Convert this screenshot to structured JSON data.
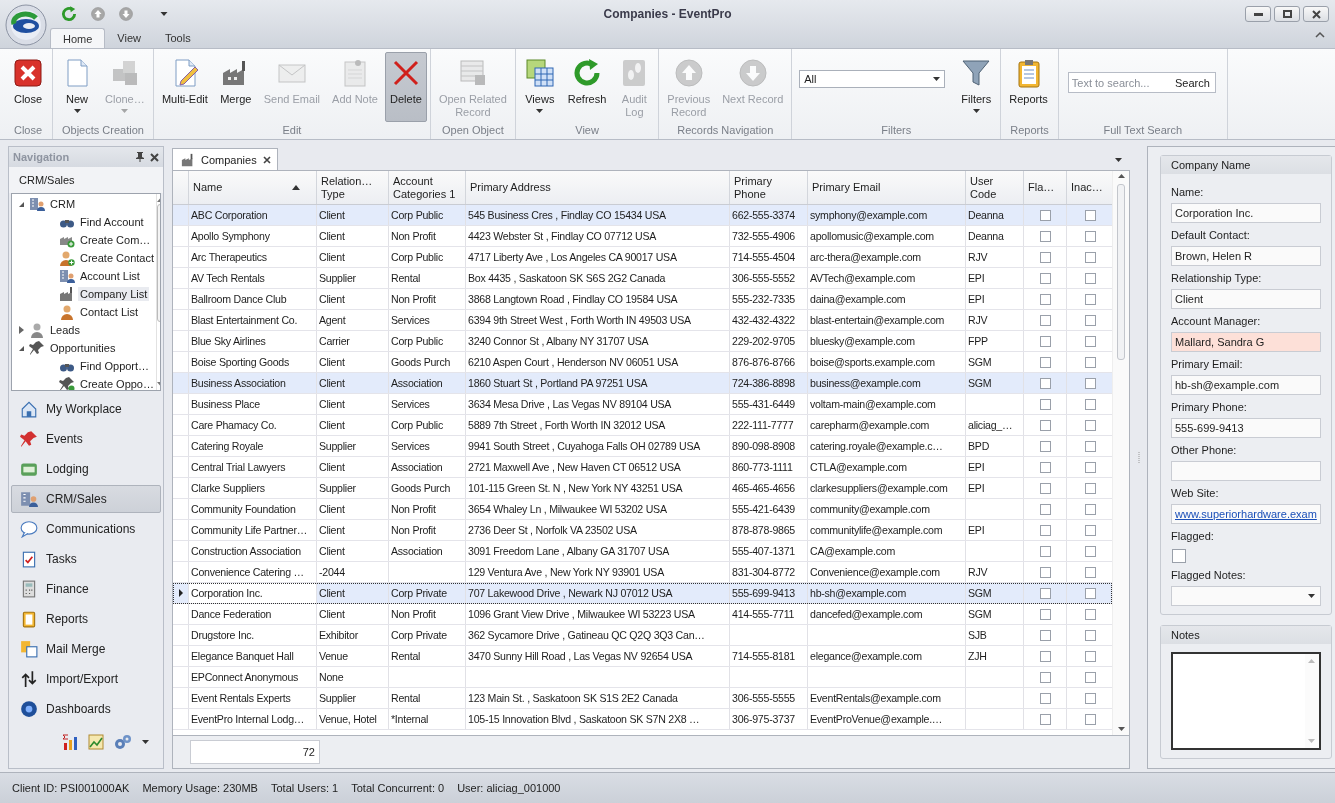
{
  "window": {
    "title": "Companies - EventPro"
  },
  "ribbon_tabs": [
    {
      "label": "Home",
      "selected": true
    },
    {
      "label": "View",
      "selected": false
    },
    {
      "label": "Tools",
      "selected": false
    }
  ],
  "ribbon_groups": [
    {
      "label": "Close",
      "buttons": [
        {
          "label": "Close",
          "disabled": false,
          "pressed": false,
          "dropdown": false
        }
      ]
    },
    {
      "label": "Objects Creation",
      "buttons": [
        {
          "label": "New",
          "disabled": false,
          "pressed": false,
          "dropdown": true
        },
        {
          "label": "Clone…",
          "disabled": true,
          "pressed": false,
          "dropdown": true
        }
      ]
    },
    {
      "label": "Edit",
      "buttons": [
        {
          "label": "Multi-Edit",
          "disabled": false,
          "pressed": false,
          "dropdown": false
        },
        {
          "label": "Merge",
          "disabled": false,
          "pressed": false,
          "dropdown": false
        },
        {
          "label": "Send Email",
          "disabled": true,
          "pressed": false,
          "dropdown": false
        },
        {
          "label": "Add Note",
          "disabled": true,
          "pressed": false,
          "dropdown": false
        },
        {
          "label": "Delete",
          "disabled": false,
          "pressed": true,
          "dropdown": false
        }
      ]
    },
    {
      "label": "Open Object",
      "buttons": [
        {
          "label": "Open Related\nRecord",
          "disabled": true,
          "pressed": false,
          "dropdown": false
        }
      ]
    },
    {
      "label": "View",
      "buttons": [
        {
          "label": "Views",
          "disabled": false,
          "pressed": false,
          "dropdown": true
        },
        {
          "label": "Refresh",
          "disabled": false,
          "pressed": false,
          "dropdown": false
        },
        {
          "label": "Audit\nLog",
          "disabled": true,
          "pressed": false,
          "dropdown": false
        }
      ]
    },
    {
      "label": "Records Navigation",
      "buttons": [
        {
          "label": "Previous\nRecord",
          "disabled": true,
          "pressed": false,
          "dropdown": false
        },
        {
          "label": "Next Record",
          "disabled": true,
          "pressed": false,
          "dropdown": false
        }
      ]
    },
    {
      "label": "Filters",
      "combo": {
        "value": "All"
      },
      "buttons": [
        {
          "label": "Filters",
          "disabled": false,
          "pressed": false,
          "dropdown": true
        }
      ]
    },
    {
      "label": "Reports",
      "buttons": [
        {
          "label": "Reports",
          "disabled": false,
          "pressed": false,
          "dropdown": false
        }
      ]
    },
    {
      "label": "Full Text Search",
      "search": {
        "placeholder": "Text to search...",
        "button": "Search"
      }
    }
  ],
  "navigation": {
    "title": "Navigation",
    "section": "CRM/Sales",
    "tree": [
      {
        "label": "CRM",
        "expanded": true,
        "selected": false,
        "children": [
          {
            "label": "Find Account",
            "selected": false
          },
          {
            "label": "Create Com…",
            "selected": false
          },
          {
            "label": "Create Contact",
            "selected": false
          },
          {
            "label": "Account List",
            "selected": false
          },
          {
            "label": "Company List",
            "selected": true
          },
          {
            "label": "Contact List",
            "selected": false
          }
        ]
      },
      {
        "label": "Leads",
        "expanded": false,
        "selected": false
      },
      {
        "label": "Opportunities",
        "expanded": true,
        "selected": false,
        "children": [
          {
            "label": "Find Opport…",
            "selected": false
          },
          {
            "label": "Create Oppo…",
            "selected": false
          }
        ]
      }
    ],
    "items": [
      {
        "label": "My Workplace",
        "selected": false
      },
      {
        "label": "Events",
        "selected": false
      },
      {
        "label": "Lodging",
        "selected": false
      },
      {
        "label": "CRM/Sales",
        "selected": true
      },
      {
        "label": "Communications",
        "selected": false
      },
      {
        "label": "Tasks",
        "selected": false
      },
      {
        "label": "Finance",
        "selected": false
      },
      {
        "label": "Reports",
        "selected": false
      },
      {
        "label": "Mail Merge",
        "selected": false
      },
      {
        "label": "Import/Export",
        "selected": false
      },
      {
        "label": "Dashboards",
        "selected": false
      }
    ]
  },
  "document_tabs": [
    {
      "label": "Companies",
      "selected": true
    }
  ],
  "table": {
    "columns": [
      {
        "label": "Name",
        "sorted": true
      },
      {
        "label": "Relation…\nType",
        "sorted": false
      },
      {
        "label": "Account\nCategories 1",
        "sorted": false
      },
      {
        "label": "Primary Address",
        "sorted": false
      },
      {
        "label": "Primary\nPhone",
        "sorted": false
      },
      {
        "label": "Primary Email",
        "sorted": false
      },
      {
        "label": "User\nCode",
        "sorted": false
      },
      {
        "label": "Fla…",
        "sorted": false
      },
      {
        "label": "Inac…",
        "sorted": false
      }
    ],
    "rows": [
      {
        "name": "ABC Corporation",
        "relationship_type": "Client",
        "account_category": "Corp Public",
        "address": "545 Business Cres , Findlay CO 15434 USA",
        "phone": "662-555-3374",
        "email": "symphony@example.com",
        "user_code": "Deanna",
        "flagged": false,
        "inactive": false,
        "selected": true,
        "focused": false
      },
      {
        "name": "Apollo Symphony",
        "relationship_type": "Client",
        "account_category": "Non Profit",
        "address": "4423 Webster St , Findlay CO 07712 USA",
        "phone": "732-555-4906",
        "email": "apollomusic@example.com",
        "user_code": "Deanna",
        "flagged": false,
        "inactive": false,
        "selected": false,
        "focused": false
      },
      {
        "name": "Arc Therapeutics",
        "relationship_type": "Client",
        "account_category": "Corp Public",
        "address": "4717 Liberty Ave , Los Angeles CA 90017 USA",
        "phone": "714-555-4504",
        "email": "arc-thera@example.com",
        "user_code": "RJV",
        "flagged": false,
        "inactive": false,
        "selected": false,
        "focused": false
      },
      {
        "name": "AV Tech Rentals",
        "relationship_type": "Supplier",
        "account_category": "Rental",
        "address": "Box 4435 , Saskatoon SK S6S 2G2 Canada",
        "phone": "306-555-5552",
        "email": "AVTech@example.com",
        "user_code": "EPI",
        "flagged": false,
        "inactive": false,
        "selected": false,
        "focused": false
      },
      {
        "name": "Ballroom Dance Club",
        "relationship_type": "Client",
        "account_category": "Non Profit",
        "address": "3868 Langtown Road , Findlay CO 19584 USA",
        "phone": "555-232-7335",
        "email": "daina@example.com",
        "user_code": "EPI",
        "flagged": false,
        "inactive": false,
        "selected": false,
        "focused": false
      },
      {
        "name": "Blast Entertainment Co.",
        "relationship_type": "Agent",
        "account_category": "Services",
        "address": "6394 9th Street West , Forth Worth IN 49503 USA",
        "phone": "432-432-4322",
        "email": "blast-entertain@example.com",
        "user_code": "RJV",
        "flagged": false,
        "inactive": false,
        "selected": false,
        "focused": false
      },
      {
        "name": "Blue Sky Airlines",
        "relationship_type": "Carrier",
        "account_category": "Corp Public",
        "address": "3240 Connor St , Albany NY 31707 USA",
        "phone": "229-202-9705",
        "email": "bluesky@example.com",
        "user_code": "FPP",
        "flagged": false,
        "inactive": false,
        "selected": false,
        "focused": false
      },
      {
        "name": "Boise Sporting Goods",
        "relationship_type": "Client",
        "account_category": "Goods Purch",
        "address": "6210 Aspen Court , Henderson NV 06051 USA",
        "phone": "876-876-8766",
        "email": "boise@sports.example.com",
        "user_code": "SGM",
        "flagged": false,
        "inactive": false,
        "selected": false,
        "focused": false
      },
      {
        "name": "Business Association",
        "relationship_type": "Client",
        "account_category": "Association",
        "address": "1860 Stuart St , Portland PA 97251 USA",
        "phone": "724-386-8898",
        "email": "business@example.com",
        "user_code": "SGM",
        "flagged": false,
        "inactive": false,
        "selected": true,
        "focused": false
      },
      {
        "name": "Business Place",
        "relationship_type": "Client",
        "account_category": "Services",
        "address": "3634 Mesa Drive , Las Vegas NV 89104 USA",
        "phone": "555-431-6449",
        "email": "voltam-main@example.com",
        "flagged": false,
        "inactive": false,
        "selected": false,
        "focused": false
      },
      {
        "name": "Care Phamacy Co.",
        "relationship_type": "Client",
        "account_category": "Corp Public",
        "address": "5889 7th Street , Forth Worth IN 32012 USA",
        "phone": "222-111-7777",
        "email": "carepharm@example.com",
        "user_code": "aliciag_…",
        "flagged": false,
        "inactive": false,
        "selected": false,
        "focused": false
      },
      {
        "name": "Catering Royale",
        "relationship_type": "Supplier",
        "account_category": "Services",
        "address": "9941 South Street , Cuyahoga Falls OH 02789 USA",
        "phone": "890-098-8908",
        "email": "catering.royale@example.c…",
        "user_code": "BPD",
        "flagged": false,
        "inactive": false,
        "selected": false,
        "focused": false
      },
      {
        "name": "Central Trial Lawyers",
        "relationship_type": "Client",
        "account_category": "Association",
        "address": "2721 Maxwell Ave , New Haven CT 06512 USA",
        "phone": "860-773-1111",
        "email": "CTLA@example.com",
        "user_code": "EPI",
        "flagged": false,
        "inactive": false,
        "selected": false,
        "focused": false
      },
      {
        "name": "Clarke Suppliers",
        "relationship_type": "Supplier",
        "account_category": "Goods Purch",
        "address": "101-115  Green St. N , New York NY 43251 USA",
        "phone": "465-465-4656",
        "email": "clarkesuppliers@example.com",
        "user_code": "EPI",
        "flagged": false,
        "inactive": false,
        "selected": false,
        "focused": false
      },
      {
        "name": "Community Foundation",
        "relationship_type": "Client",
        "account_category": "Non Profit",
        "address": "3654 Whaley Ln , Milwaukee WI 53202 USA",
        "phone": "555-421-6439",
        "email": "community@example.com",
        "flagged": false,
        "inactive": false,
        "selected": false,
        "focused": false
      },
      {
        "name": "Community Life Partner…",
        "relationship_type": "Client",
        "account_category": "Non Profit",
        "address": "2736 Deer St , Norfolk VA 23502 USA",
        "phone": "878-878-9865",
        "email": "communitylife@example.com",
        "user_code": "EPI",
        "flagged": false,
        "inactive": false,
        "selected": false,
        "focused": false
      },
      {
        "name": "Construction Association",
        "relationship_type": "Client",
        "account_category": "Association",
        "address": "3091 Freedom Lane , Albany GA 31707 USA",
        "phone": "555-407-1371",
        "email": "CA@example.com",
        "flagged": false,
        "inactive": false,
        "selected": false,
        "focused": false
      },
      {
        "name": "Convenience Catering …",
        "relationship_type": "-2044",
        "address": "129 Ventura Ave , New York NY 93901 USA",
        "phone": "831-304-8772",
        "email": "Convenience@example.com",
        "user_code": "RJV",
        "flagged": false,
        "inactive": false,
        "selected": false,
        "focused": false
      },
      {
        "name": "Corporation Inc.",
        "relationship_type": "Client",
        "account_category": "Corp Private",
        "address": "707 Lakewood Drive , Newark NJ 07012 USA",
        "phone": "555-699-9413",
        "email": "hb-sh@example.com",
        "user_code": "SGM",
        "flagged": false,
        "inactive": false,
        "selected": true,
        "focused": true
      },
      {
        "name": "Dance Federation",
        "relationship_type": "Client",
        "account_category": "Non Profit",
        "address": "1096 Grant View Drive , Milwaukee WI 53223 USA",
        "phone": "414-555-7711",
        "email": "dancefed@example.com",
        "user_code": "SGM",
        "flagged": false,
        "inactive": false,
        "selected": false,
        "focused": false
      },
      {
        "name": "Drugstore Inc.",
        "relationship_type": "Exhibitor",
        "account_category": "Corp Private",
        "address": "362 Sycamore Drive , Gatineau QC Q2Q 3Q3 Can…",
        "user_code": "SJB",
        "flagged": false,
        "inactive": false,
        "selected": false,
        "focused": false
      },
      {
        "name": "Elegance Banquet Hall",
        "relationship_type": "Venue",
        "account_category": "Rental",
        "address": "3470 Sunny Hill Road , Las Vegas NV 92654 USA",
        "phone": "714-555-8181",
        "email": "elegance@example.com",
        "user_code": "ZJH",
        "flagged": false,
        "inactive": false,
        "selected": false,
        "focused": false
      },
      {
        "name": "EPConnect Anonymous",
        "relationship_type": "None",
        "flagged": false,
        "inactive": false,
        "selected": false,
        "focused": false
      },
      {
        "name": "Event Rentals Experts",
        "relationship_type": "Supplier",
        "account_category": "Rental",
        "address": "123 Main St. , Saskatoon SK S1S 2E2 Canada",
        "phone": "306-555-5555",
        "email": "EventRentals@example.com",
        "flagged": false,
        "inactive": false,
        "selected": false,
        "focused": false
      },
      {
        "name": "EventPro Internal Lodg…",
        "relationship_type": "Venue, Hotel",
        "account_category": "*Internal",
        "address": "105-15 Innovation Blvd , Saskatoon SK S7N 2X8 …",
        "phone": "306-975-3737",
        "email": "EventProVenue@example.…",
        "flagged": false,
        "inactive": false,
        "selected": false,
        "focused": false
      }
    ],
    "row_count": "72"
  },
  "details": {
    "title": "Company Name",
    "fields": [
      {
        "label": "Name:",
        "kind": "text",
        "value": "Corporation Inc.",
        "highlighted": false
      },
      {
        "label": "Default Contact:",
        "kind": "text",
        "value": "Brown, Helen R",
        "highlighted": false
      },
      {
        "label": "Relationship Type:",
        "kind": "text",
        "value": "Client",
        "highlighted": false
      },
      {
        "label": "Account Manager:",
        "kind": "text",
        "value": "Mallard, Sandra G",
        "highlighted": true
      },
      {
        "label": "Primary Email:",
        "kind": "text",
        "value": "hb-sh@example.com",
        "highlighted": false
      },
      {
        "label": "Primary Phone:",
        "kind": "text",
        "value": "555-699-9413",
        "highlighted": false
      },
      {
        "label": "Other Phone:",
        "kind": "text",
        "highlighted": false
      },
      {
        "label": "Web Site:",
        "kind": "link",
        "value": "www.superiorhardware.exam",
        "highlighted": false
      },
      {
        "label": "Flagged:",
        "kind": "checkbox",
        "checked": false
      },
      {
        "label": "Flagged Notes:",
        "kind": "dropdown"
      }
    ],
    "notes_title": "Notes"
  },
  "status_bar": [
    "Client ID: PSI001000AK",
    "Memory Usage: 230MB",
    "Total Users: 1",
    "Total Concurrent: 0",
    "User: aliciag_001000"
  ]
}
